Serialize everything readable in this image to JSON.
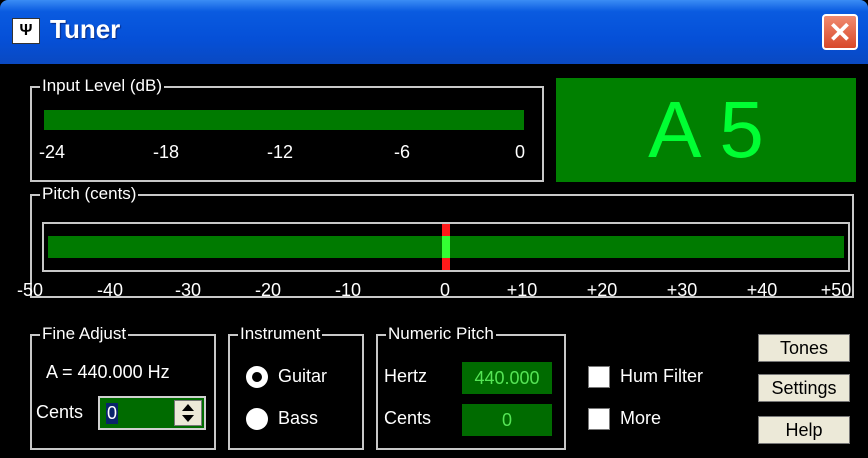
{
  "window": {
    "title": "Tuner",
    "icon": "tuning-fork-icon",
    "close": "close-icon"
  },
  "colors": {
    "meter_green": "#007a00",
    "note_green": "#00ff33",
    "needle_red": "#ff1a1a",
    "needle_green": "#33ff33",
    "display_bg": "#008000"
  },
  "input_level": {
    "label": "Input Level (dB)",
    "ticks": [
      "-24",
      "-18",
      "-12",
      "-6",
      "0"
    ]
  },
  "note_display": {
    "note": "A 5"
  },
  "pitch": {
    "label": "Pitch (cents)",
    "ticks": [
      "-50",
      "-40",
      "-30",
      "-20",
      "-10",
      "0",
      "+10",
      "+20",
      "+30",
      "+40",
      "+50"
    ],
    "needle_cents": 0
  },
  "fine_adjust": {
    "label": "Fine Adjust",
    "reference": "A = 440.000 Hz",
    "cents_label": "Cents",
    "cents_value": "0"
  },
  "instrument": {
    "label": "Instrument",
    "options": [
      "Guitar",
      "Bass"
    ],
    "selected": "Guitar"
  },
  "numeric_pitch": {
    "label": "Numeric Pitch",
    "hertz_label": "Hertz",
    "hertz_value": "440.000",
    "cents_label": "Cents",
    "cents_value": "0"
  },
  "options": {
    "hum_filter": {
      "label": "Hum Filter",
      "checked": false
    },
    "more": {
      "label": "More",
      "checked": false
    }
  },
  "buttons": {
    "tones": "Tones",
    "settings": "Settings",
    "help": "Help"
  }
}
